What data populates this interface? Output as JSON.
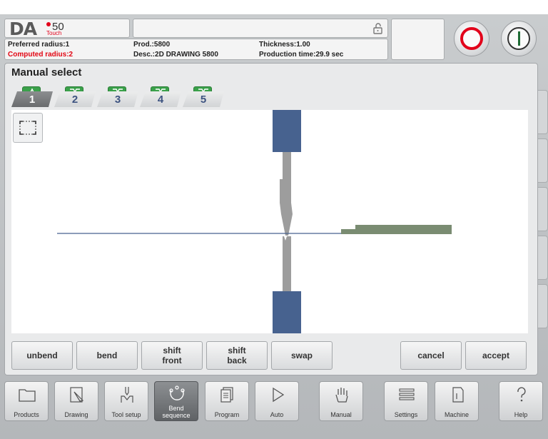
{
  "header": {
    "logo_text": "DA",
    "logo_model": "50",
    "logo_sub": "Touch",
    "preferred_radius": "Preferred radius:1",
    "computed_radius": "Computed radius:2",
    "prod": "Prod.:5800",
    "desc": "Desc.:2D DRAWING 5800",
    "thickness": "Thickness:1.00",
    "production_time": "Production time:29.9 sec"
  },
  "panel": {
    "title": "Manual select"
  },
  "steps": [
    {
      "label": "1",
      "active": true
    },
    {
      "label": "2",
      "active": false
    },
    {
      "label": "3",
      "active": false
    },
    {
      "label": "4",
      "active": false
    },
    {
      "label": "5",
      "active": false
    }
  ],
  "actions": {
    "unbend": "unbend",
    "bend": "bend",
    "shift_front": "shift\nfront",
    "shift_back": "shift\nback",
    "swap": "swap",
    "cancel": "cancel",
    "accept": "accept"
  },
  "nav": [
    {
      "label": "Products",
      "icon": "folder-icon"
    },
    {
      "label": "Drawing",
      "icon": "pencil-icon"
    },
    {
      "label": "Tool setup",
      "icon": "tool-icon"
    },
    {
      "label": "Bend\nsequence",
      "icon": "bend-sequence-icon"
    },
    {
      "label": "Program",
      "icon": "pages-icon"
    },
    {
      "label": "Auto",
      "icon": "play-icon"
    },
    {
      "label": "Manual",
      "icon": "hand-icon"
    },
    {
      "label": "Settings",
      "icon": "list-icon"
    },
    {
      "label": "Machine",
      "icon": "machine-icon"
    },
    {
      "label": "Help",
      "icon": "question-icon"
    }
  ],
  "colors": {
    "tool_blue": "#47628f",
    "punch_grey": "#9d9d9d",
    "part_green": "#7a8c72",
    "active_green": "#3aa14a",
    "stop_red": "#e2001a"
  }
}
